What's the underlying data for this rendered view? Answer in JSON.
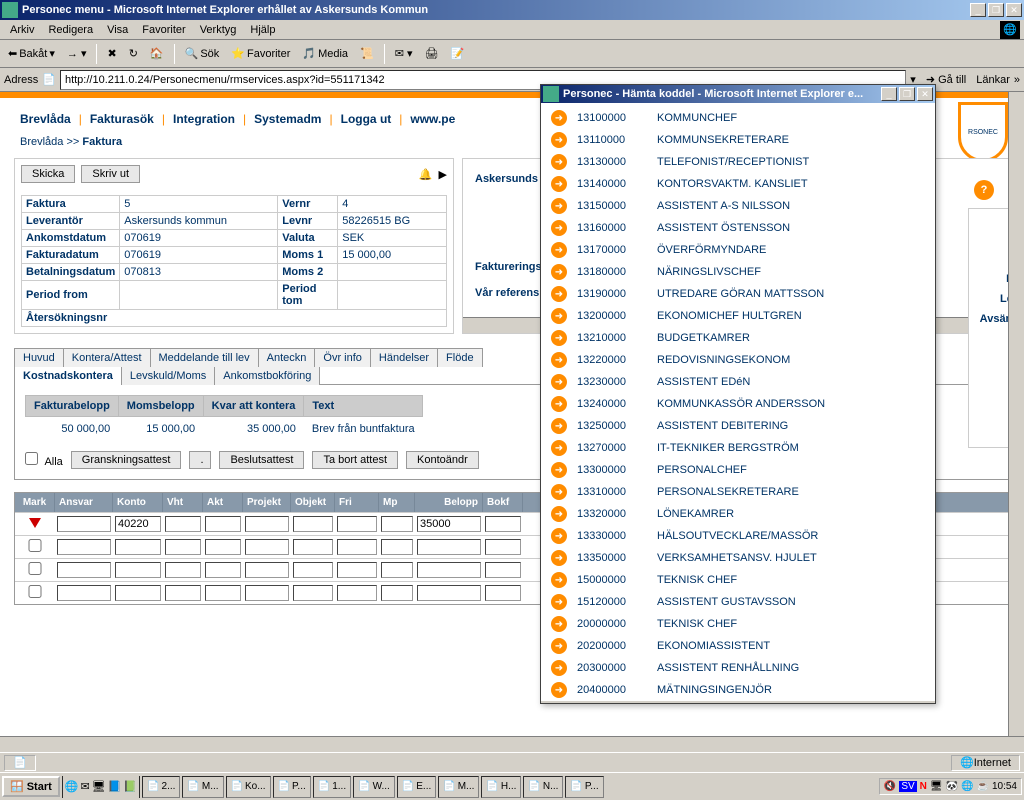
{
  "window": {
    "title": "Personec menu - Microsoft Internet Explorer erhållet av Askersunds Kommun"
  },
  "menubar": [
    "Arkiv",
    "Redigera",
    "Visa",
    "Favoriter",
    "Verktyg",
    "Hjälp"
  ],
  "toolbar": {
    "back": "Bakåt",
    "search": "Sök",
    "favorites": "Favoriter",
    "media": "Media"
  },
  "address": {
    "label": "Adress",
    "url": "http://10.211.0.24/Personecmenu/rmservices.aspx?id=551171342",
    "go": "Gå till",
    "links": "Länkar"
  },
  "nav": [
    "Brevlåda",
    "Fakturasök",
    "Integration",
    "Systemadm",
    "Logga ut",
    "www.pe"
  ],
  "breadcrumb": {
    "root": "Brevlåda",
    "sep": ">>",
    "current": "Faktura"
  },
  "buttons": {
    "skicka": "Skicka",
    "skrivut": "Skriv ut"
  },
  "logo_text": "RSONEC",
  "info": {
    "faktura_l": "Faktura",
    "faktura_v": "5",
    "vernr_l": "Vernr",
    "vernr_v": "4",
    "lev_l": "Leverantör",
    "lev_v": "Askersunds kommun",
    "levnr_l": "Levnr",
    "levnr_v": "58226515 BG",
    "ankomst_l": "Ankomstdatum",
    "ankomst_v": "070619",
    "valuta_l": "Valuta",
    "valuta_v": "SEK",
    "fdatum_l": "Fakturadatum",
    "fdatum_v": "070619",
    "moms1_l": "Moms 1",
    "moms1_v": "15 000,00",
    "betal_l": "Betalningsdatum",
    "betal_v": "070813",
    "moms2_l": "Moms 2",
    "moms2_v": "",
    "pfrom_l": "Period from",
    "pfrom_v": "",
    "ptom_l": "Period tom",
    "ptom_v": "",
    "ater_l": "Återsökningsnr"
  },
  "right_info": {
    "title": "Askersunds k",
    "fakt": "Faktureringsp",
    "ref": "Vår referens"
  },
  "right_side": {
    "fa": "Fa",
    "lev": "Lev",
    "avsand": "Avsänd"
  },
  "tabs_row1": [
    "Huvud",
    "Kontera/Attest",
    "Meddelande till lev",
    "Anteckn",
    "Övr info",
    "Händelser",
    "Flöde"
  ],
  "tabs_row2": [
    "Kostnadskontera",
    "Levskuld/Moms",
    "Ankomstbokföring"
  ],
  "sum": {
    "h1": "Fakturabelopp",
    "h2": "Momsbelopp",
    "h3": "Kvar att kontera",
    "h4": "Text",
    "v1": "50 000,00",
    "v2": "15 000,00",
    "v3": "35 000,00",
    "v4": "Brev från buntfaktura"
  },
  "actions": {
    "alla": "Alla",
    "gransk": "Granskningsattest",
    "dot": ".",
    "beslut": "Beslutsattest",
    "tabort": "Ta bort attest",
    "konto": "Kontoändr"
  },
  "grid_head": [
    "Mark",
    "Ansvar",
    "Konto",
    "Vht",
    "Akt",
    "Projekt",
    "Objekt",
    "Fri",
    "Mp",
    "Belopp",
    "Bokf"
  ],
  "grid_row1": {
    "konto": "40220",
    "belopp": "35000"
  },
  "popup": {
    "title": "Personec - Hämta koddel - Microsoft Internet Explorer e...",
    "items": [
      {
        "code": "13100000",
        "name": "KOMMUNCHEF"
      },
      {
        "code": "13110000",
        "name": "KOMMUNSEKRETERARE"
      },
      {
        "code": "13130000",
        "name": "TELEFONIST/RECEPTIONIST"
      },
      {
        "code": "13140000",
        "name": "KONTORSVAKTM. KANSLIET"
      },
      {
        "code": "13150000",
        "name": "ASSISTENT A-S NILSSON"
      },
      {
        "code": "13160000",
        "name": "ASSISTENT ÖSTENSSON"
      },
      {
        "code": "13170000",
        "name": "ÖVERFÖRMYNDARE"
      },
      {
        "code": "13180000",
        "name": "NÄRINGSLIVSCHEF"
      },
      {
        "code": "13190000",
        "name": "UTREDARE GÖRAN MATTSSON"
      },
      {
        "code": "13200000",
        "name": "EKONOMICHEF HULTGREN"
      },
      {
        "code": "13210000",
        "name": "BUDGETKAMRER"
      },
      {
        "code": "13220000",
        "name": "REDOVISNINGSEKONOM"
      },
      {
        "code": "13230000",
        "name": "ASSISTENT EDéN"
      },
      {
        "code": "13240000",
        "name": "KOMMUNKASSÖR ANDERSSON"
      },
      {
        "code": "13250000",
        "name": "ASSISTENT DEBITERING"
      },
      {
        "code": "13270000",
        "name": "IT-TEKNIKER BERGSTRÖM"
      },
      {
        "code": "13300000",
        "name": "PERSONALCHEF"
      },
      {
        "code": "13310000",
        "name": "PERSONALSEKRETERARE"
      },
      {
        "code": "13320000",
        "name": "LÖNEKAMRER"
      },
      {
        "code": "13330000",
        "name": "HÄLSOUTVECKLARE/MASSÖR"
      },
      {
        "code": "13350000",
        "name": "VERKSAMHETSANSV. HJULET"
      },
      {
        "code": "15000000",
        "name": "TEKNISK CHEF"
      },
      {
        "code": "15120000",
        "name": "ASSISTENT GUSTAVSSON"
      },
      {
        "code": "20000000",
        "name": "TEKNISK CHEF"
      },
      {
        "code": "20200000",
        "name": "EKONOMIASSISTENT"
      },
      {
        "code": "20300000",
        "name": "ASSISTENT RENHÅLLNING"
      },
      {
        "code": "20400000",
        "name": "MÄTNINGSINGENJÖR"
      }
    ]
  },
  "status": {
    "zone": "Internet"
  },
  "taskbar": {
    "start": "Start",
    "tasks": [
      "2...",
      "M...",
      "Ko...",
      "P...",
      "1...",
      "W...",
      "E...",
      "M...",
      "H...",
      "N...",
      "P..."
    ],
    "clock": "10:54",
    "lang": "SV"
  }
}
